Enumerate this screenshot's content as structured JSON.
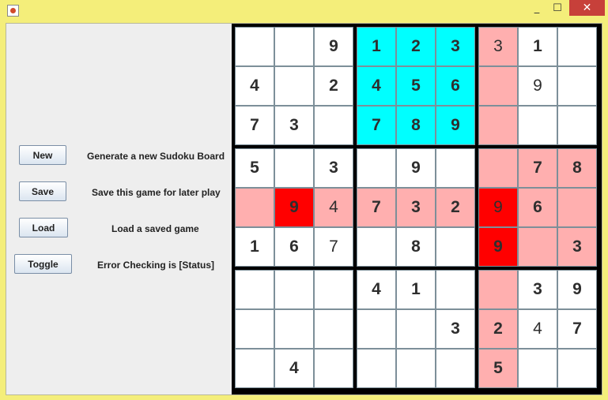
{
  "window": {
    "controls": {
      "minimize": "_",
      "maximize": "☐",
      "close": "✕"
    }
  },
  "buttons": [
    {
      "label": "New",
      "description": "Generate a new Sudoku Board"
    },
    {
      "label": "Save",
      "description": "Save this game for later play"
    },
    {
      "label": "Load",
      "description": "Load a saved game"
    },
    {
      "label": "Toggle",
      "description": "Error Checking is [Status]"
    }
  ],
  "colors": {
    "highlight_block": "#00ffff",
    "conflict": "#ffafaf",
    "error": "#ff0000"
  },
  "board": {
    "values": [
      [
        "",
        "",
        "9",
        "1",
        "2",
        "3",
        "3",
        "1",
        ""
      ],
      [
        "4",
        "",
        "2",
        "4",
        "5",
        "6",
        "",
        "9",
        ""
      ],
      [
        "7",
        "3",
        "",
        "7",
        "8",
        "9",
        "",
        "",
        ""
      ],
      [
        "5",
        "",
        "3",
        "",
        "9",
        "",
        "",
        "7",
        "8"
      ],
      [
        "",
        "9",
        "4",
        "7",
        "3",
        "2",
        "9",
        "6",
        ""
      ],
      [
        "1",
        "6",
        "7",
        "",
        "8",
        "",
        "9",
        "",
        "3"
      ],
      [
        "",
        "",
        "",
        "4",
        "1",
        "",
        "",
        "3",
        "9"
      ],
      [
        "",
        "",
        "",
        "",
        "",
        "3",
        "2",
        "4",
        "7"
      ],
      [
        "",
        "4",
        "",
        "",
        "",
        "",
        "5",
        "",
        ""
      ]
    ],
    "bold": [
      [
        0,
        0,
        1,
        1,
        1,
        1,
        0,
        1,
        0
      ],
      [
        1,
        0,
        1,
        1,
        1,
        1,
        0,
        0,
        0
      ],
      [
        1,
        1,
        0,
        1,
        1,
        1,
        0,
        0,
        0
      ],
      [
        1,
        0,
        1,
        0,
        1,
        0,
        0,
        1,
        1
      ],
      [
        0,
        1,
        0,
        1,
        1,
        1,
        0,
        1,
        0
      ],
      [
        1,
        1,
        0,
        0,
        1,
        0,
        1,
        0,
        1
      ],
      [
        0,
        0,
        0,
        1,
        1,
        0,
        0,
        1,
        1
      ],
      [
        0,
        0,
        0,
        0,
        0,
        1,
        1,
        0,
        1
      ],
      [
        0,
        1,
        0,
        0,
        0,
        0,
        1,
        0,
        0
      ]
    ],
    "cell_states": [
      [
        "",
        "",
        "",
        "cyan",
        "cyan",
        "cyan",
        "pink",
        "",
        ""
      ],
      [
        "",
        "",
        "",
        "cyan",
        "cyan",
        "cyan",
        "pink",
        "",
        ""
      ],
      [
        "",
        "",
        "",
        "cyan",
        "cyan",
        "cyan",
        "pink",
        "",
        ""
      ],
      [
        "",
        "",
        "",
        "",
        "",
        "",
        "pink",
        "pink",
        "pink"
      ],
      [
        "pink",
        "red",
        "pink",
        "pink",
        "pink",
        "pink",
        "red",
        "pink",
        "pink"
      ],
      [
        "",
        "",
        "",
        "",
        "",
        "",
        "red",
        "pink",
        "pink"
      ],
      [
        "",
        "",
        "",
        "",
        "",
        "",
        "pink",
        "",
        ""
      ],
      [
        "",
        "",
        "",
        "",
        "",
        "",
        "pink",
        "",
        ""
      ],
      [
        "",
        "",
        "",
        "",
        "",
        "",
        "pink",
        "",
        ""
      ]
    ]
  }
}
